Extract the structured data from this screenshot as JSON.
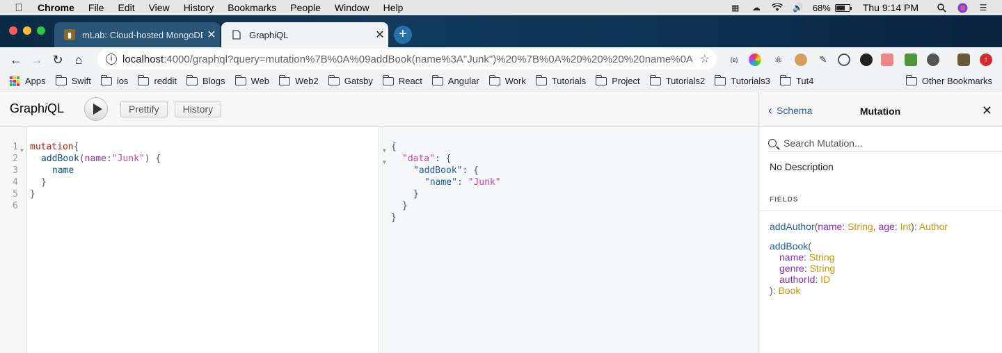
{
  "menubar": {
    "items": [
      "Chrome",
      "File",
      "Edit",
      "View",
      "History",
      "Bookmarks",
      "People",
      "Window",
      "Help"
    ],
    "battery_pct": "68%",
    "battery_level": 0.68,
    "clock": "Thu 9:14 PM"
  },
  "tabs": [
    {
      "title": "mLab: Cloud-hosted MongoDB",
      "favicon": "mlab-icon",
      "active": false
    },
    {
      "title": "GraphiQL",
      "favicon": "page-icon",
      "active": true
    }
  ],
  "toolbar": {
    "url_host": "localhost",
    "url_path": ":4000/graphql?query=mutation%7B%0A%09addBook(name%3A\"Junk\")%20%7B%0A%20%20%20%20name%0A..."
  },
  "bookmarks": {
    "apps_label": "Apps",
    "folders": [
      "Swift",
      "ios",
      "reddit",
      "Blogs",
      "Web",
      "Web2",
      "Gatsby",
      "React",
      "Angular",
      "Work",
      "Tutorials",
      "Project",
      "Tutorials2",
      "Tutorials3",
      "Tut4"
    ],
    "other_label": "Other Bookmarks"
  },
  "graphiql": {
    "logo_pre": "Graph",
    "logo_i": "i",
    "logo_post": "QL",
    "prettify_label": "Prettify",
    "history_label": "History"
  },
  "editor": {
    "line_numbers": [
      "1",
      "2",
      "3",
      "4",
      "5",
      "6"
    ],
    "t_mutation": "mutation",
    "t_open": "{",
    "t_addBook": "addBook",
    "t_paren_open": "(",
    "t_arg": "name",
    "t_colon": ":",
    "t_value": "\"Junk\"",
    "t_paren_close": ")",
    "t_space_open": " {",
    "t_field": "name",
    "t_close_inner": "}",
    "t_close_outer": "}"
  },
  "result": {
    "open": "{",
    "k_data": "\"data\"",
    "colon_open": ": {",
    "k_addBook": "\"addBook\"",
    "k_name": "\"name\"",
    "colon": ": ",
    "v_name": "\"Junk\"",
    "close": "}"
  },
  "docs": {
    "back_label": "Schema",
    "title": "Mutation",
    "search_placeholder": "Search Mutation...",
    "description": "No Description",
    "section": "FIELDS",
    "f1_name": "addAuthor",
    "f1_args": [
      {
        "name": "name",
        "type": "String"
      },
      {
        "name": "age",
        "type": "Int"
      }
    ],
    "f1_return": "Author",
    "f2_name": "addBook",
    "f2_args": [
      {
        "name": "name",
        "type": "String"
      },
      {
        "name": "genre",
        "type": "String"
      },
      {
        "name": "authorId",
        "type": "ID"
      }
    ],
    "f2_return": "Book",
    "p_open": "(",
    "p_colon": ": ",
    "p_comma": ", ",
    "p_close": "): "
  },
  "colors": {
    "keyword": "#b11a04",
    "def": "#0b4f8c",
    "attribute": "#8b2bb9",
    "string": "#d64292",
    "type": "#ca9800"
  }
}
